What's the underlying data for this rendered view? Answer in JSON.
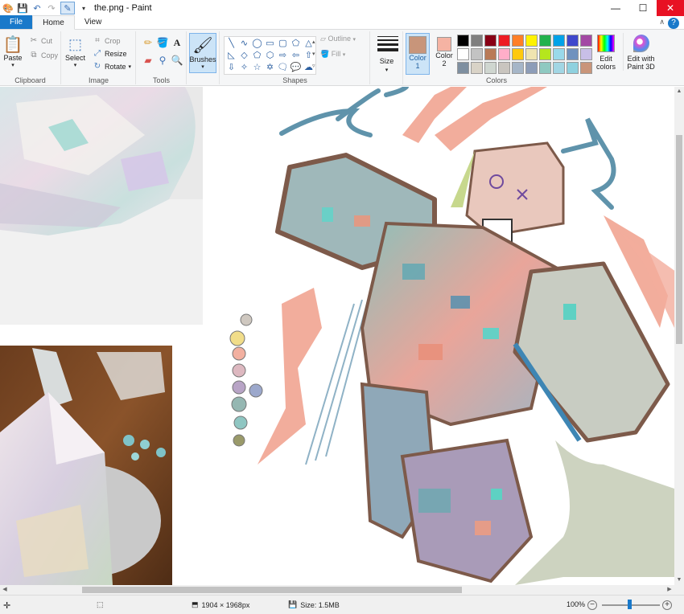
{
  "window": {
    "title": "the.png - Paint",
    "minimize": "—",
    "maximize": "☐",
    "close": "✕"
  },
  "tabs": [
    {
      "label": "File"
    },
    {
      "label": "Home"
    },
    {
      "label": "View"
    }
  ],
  "ribbon": {
    "clipboard": {
      "label": "Clipboard",
      "paste": "Paste",
      "cut": "Cut",
      "copy": "Copy"
    },
    "image": {
      "label": "Image",
      "select": "Select",
      "crop": "Crop",
      "resize": "Resize",
      "rotate": "Rotate"
    },
    "tools": {
      "label": "Tools"
    },
    "brushes": {
      "label": "Brushes"
    },
    "shapes": {
      "label": "Shapes",
      "outline": "Outline",
      "fill": "Fill"
    },
    "size": {
      "label": "Size"
    },
    "colors": {
      "label": "Colors",
      "color1_label": "Color",
      "color1_num": "1",
      "color1_hex": "#c8957a",
      "color2_label": "Color",
      "color2_num": "2",
      "color2_hex": "#f5b3a3",
      "edit_colors": "Edit colors",
      "edit_paint3d": "Edit with Paint 3D",
      "palette": [
        "#000000",
        "#7f7f7f",
        "#880015",
        "#ed1c24",
        "#ff7f27",
        "#fff200",
        "#22b14c",
        "#00a2e8",
        "#3f48cc",
        "#a349a4",
        "#ffffff",
        "#c3c3c3",
        "#b97a57",
        "#ffaec9",
        "#ffc90e",
        "#efe4b0",
        "#b5e61d",
        "#99d9ea",
        "#7092be",
        "#c8bfe7",
        "#7e8fa0",
        "#d9d3c7",
        "#cfd6d0",
        "#c9c5bf",
        "#a6b6c8",
        "#8d9db8",
        "#8fc9c1",
        "#a2d6e4",
        "#8fd1df",
        "#c9957a"
      ]
    }
  },
  "status": {
    "dimensions": "1904 × 1968px",
    "size": "Size: 1.5MB",
    "zoom": "100%",
    "zoom_minus": "−",
    "zoom_plus": "+"
  }
}
